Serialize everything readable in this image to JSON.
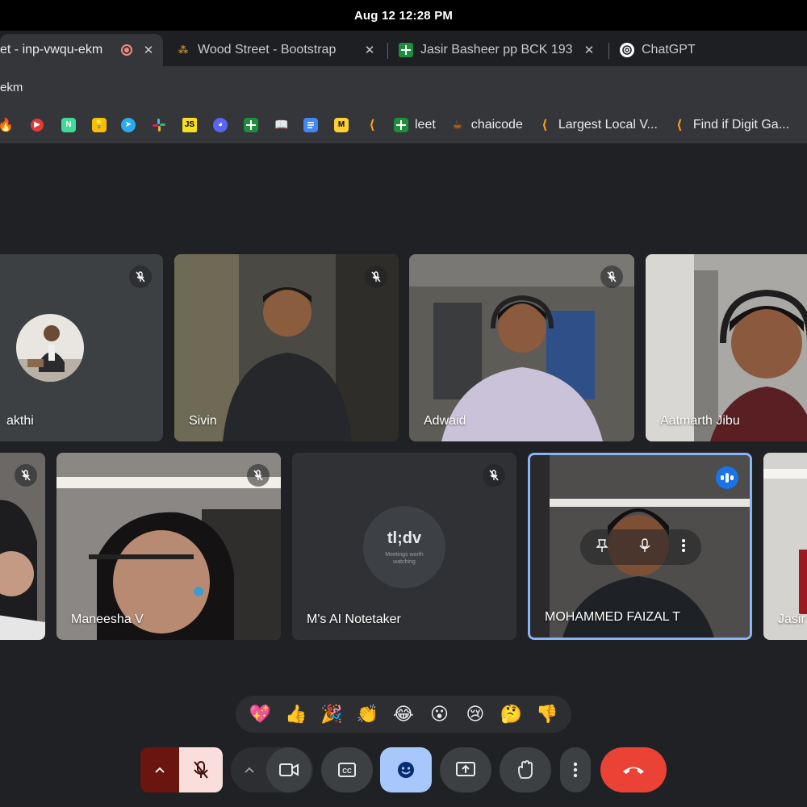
{
  "system": {
    "clock": "Aug 12  12:28 PM"
  },
  "tabs": [
    {
      "title": "et - inp-vwqu-ekm",
      "active": true
    },
    {
      "title": "Wood Street - Bootstrap",
      "active": false
    },
    {
      "title": "Jasir Basheer pp BCK 193",
      "active": false
    },
    {
      "title": "ChatGPT",
      "active": false
    }
  ],
  "address": {
    "url": "ekm"
  },
  "bookmarks": [
    {
      "icon": "fire-icon",
      "label": ""
    },
    {
      "icon": "play-icon",
      "label": ""
    },
    {
      "icon": "notion-n-icon",
      "label": ""
    },
    {
      "icon": "keep-bulb-icon",
      "label": ""
    },
    {
      "icon": "telegram-icon",
      "label": ""
    },
    {
      "icon": "slack-icon",
      "label": ""
    },
    {
      "icon": "js-icon",
      "label": ""
    },
    {
      "icon": "discord-icon",
      "label": ""
    },
    {
      "icon": "sheets-icon",
      "label": ""
    },
    {
      "icon": "book-icon",
      "label": ""
    },
    {
      "icon": "docs-icon",
      "label": ""
    },
    {
      "icon": "miro-icon",
      "label": ""
    },
    {
      "icon": "leetcode-icon",
      "label": ""
    },
    {
      "icon": "sheets-icon",
      "label": "leet"
    },
    {
      "icon": "chaicode-icon",
      "label": "chaicode"
    },
    {
      "icon": "leetcode-icon",
      "label": "Largest Local V..."
    },
    {
      "icon": "leetcode-icon",
      "label": "Find if Digit Ga..."
    }
  ],
  "participants_row1": [
    {
      "name": "akthi",
      "muted": true
    },
    {
      "name": "Sivin",
      "muted": true
    },
    {
      "name": "Adwaid",
      "muted": true
    },
    {
      "name": "Aatmarth Jibu",
      "muted": false
    }
  ],
  "participants_row2": [
    {
      "name": "",
      "muted": true
    },
    {
      "name": "Maneesha V",
      "muted": true
    },
    {
      "name": "M's AI Notetaker",
      "muted": true
    },
    {
      "name": "MOHAMMED FAIZAL T",
      "muted": false,
      "speaking": true
    },
    {
      "name": "Jasir",
      "muted": false
    }
  ],
  "tldv": {
    "logo": "tl;dv",
    "tagline": "Meetings worth watching"
  },
  "reactions": [
    "💖",
    "👍",
    "🎉",
    "👏",
    "😂",
    "😮",
    "😢",
    "🤔",
    "👎"
  ],
  "colors": {
    "bg": "#202124",
    "tile": "#3c4043",
    "accent": "#8ab4f8",
    "end": "#ea4335",
    "mic_off_bg": "#f9dedc"
  }
}
